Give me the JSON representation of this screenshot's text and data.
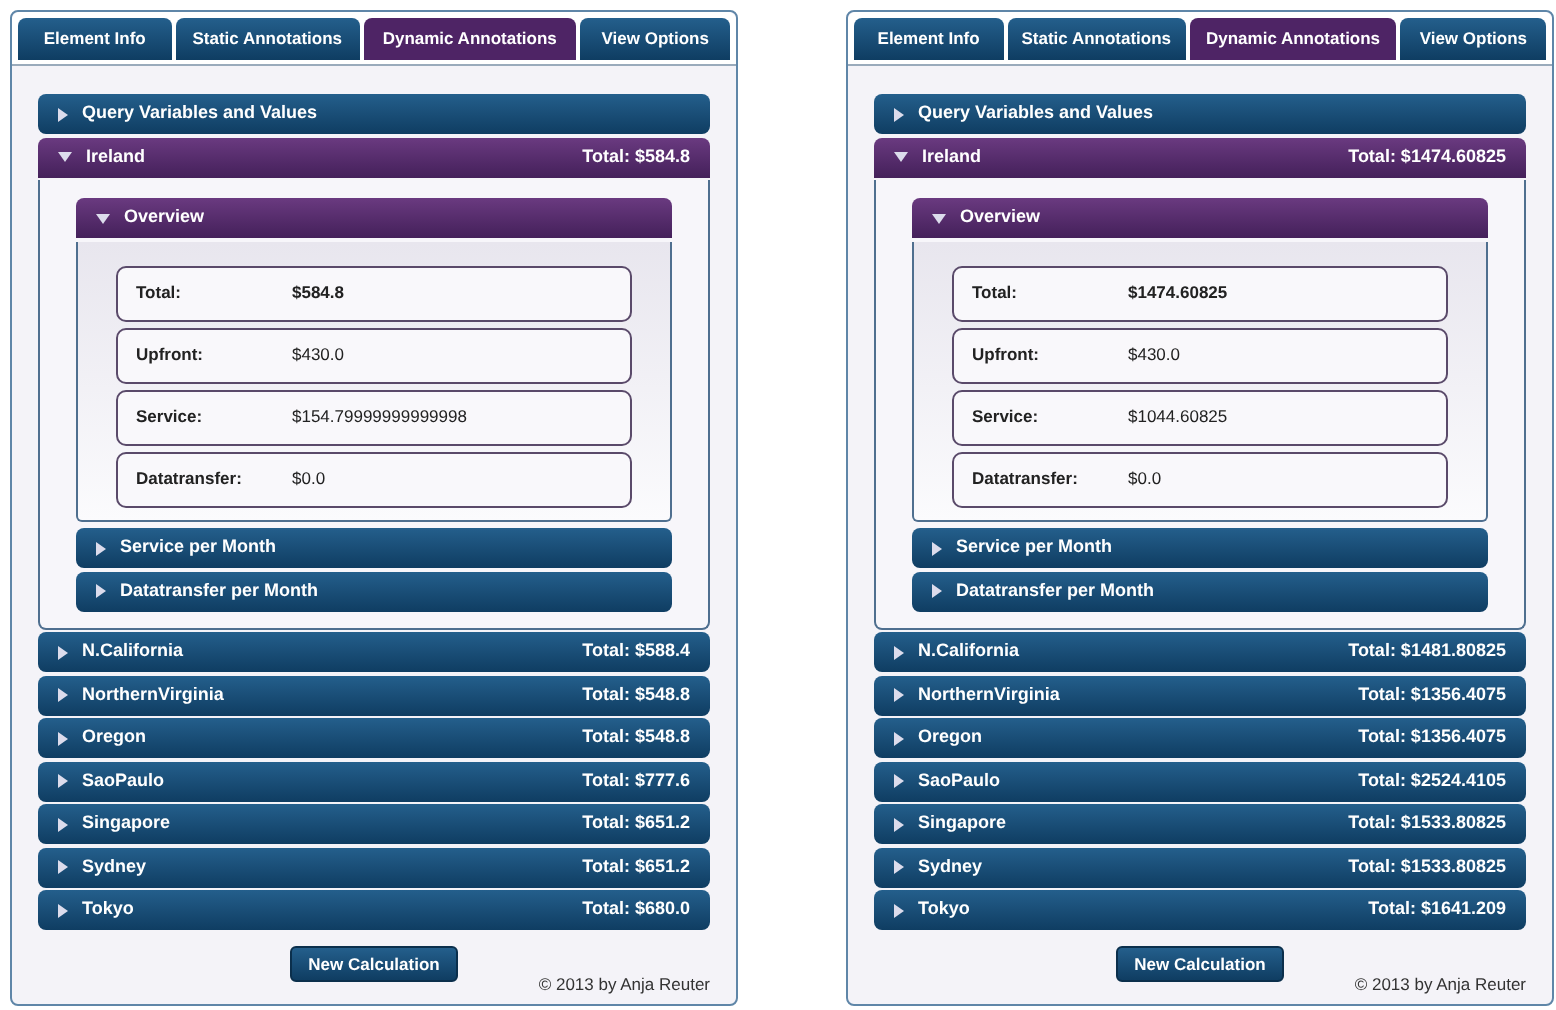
{
  "panels": [
    {
      "tabs": [
        {
          "label": "Element Info",
          "selected": false
        },
        {
          "label": "Static Annotations",
          "selected": false
        },
        {
          "label": "Dynamic Annotations",
          "selected": true
        },
        {
          "label": "View Options",
          "selected": false
        }
      ],
      "sections": [
        {
          "title": "Query Variables and Values",
          "expanded": false
        },
        {
          "title": "Ireland",
          "total": "Total: $584.8",
          "expanded": true,
          "subsections": [
            {
              "title": "Overview",
              "expanded": true,
              "rows": [
                {
                  "label": "Total:",
                  "value": "$584.8"
                },
                {
                  "label": "Upfront:",
                  "value": "$430.0"
                },
                {
                  "label": "Service:",
                  "value": "$154.79999999999998"
                },
                {
                  "label": "Datatransfer:",
                  "value": "$0.0"
                }
              ]
            },
            {
              "title": "Service per Month",
              "expanded": false
            },
            {
              "title": "Datatransfer per Month",
              "expanded": false
            }
          ]
        },
        {
          "title": "N.California",
          "total": "Total: $588.4",
          "expanded": false
        },
        {
          "title": "NorthernVirginia",
          "total": "Total: $548.8",
          "expanded": false
        },
        {
          "title": "Oregon",
          "total": "Total: $548.8",
          "expanded": false
        },
        {
          "title": "SaoPaulo",
          "total": "Total: $777.6",
          "expanded": false
        },
        {
          "title": "Singapore",
          "total": "Total: $651.2",
          "expanded": false
        },
        {
          "title": "Sydney",
          "total": "Total: $651.2",
          "expanded": false
        },
        {
          "title": "Tokyo",
          "total": "Total: $680.0",
          "expanded": false
        }
      ],
      "button": "New Calculation",
      "footer": "© 2013 by Anja Reuter"
    },
    {
      "tabs": [
        {
          "label": "Element Info",
          "selected": false
        },
        {
          "label": "Static Annotations",
          "selected": false
        },
        {
          "label": "Dynamic Annotations",
          "selected": true
        },
        {
          "label": "View Options",
          "selected": false
        }
      ],
      "sections": [
        {
          "title": "Query Variables and Values",
          "expanded": false
        },
        {
          "title": "Ireland",
          "total": "Total: $1474.60825",
          "expanded": true,
          "subsections": [
            {
              "title": "Overview",
              "expanded": true,
              "rows": [
                {
                  "label": "Total:",
                  "value": "$1474.60825"
                },
                {
                  "label": "Upfront:",
                  "value": "$430.0"
                },
                {
                  "label": "Service:",
                  "value": "$1044.60825"
                },
                {
                  "label": "Datatransfer:",
                  "value": "$0.0"
                }
              ]
            },
            {
              "title": "Service per Month",
              "expanded": false
            },
            {
              "title": "Datatransfer per Month",
              "expanded": false
            }
          ]
        },
        {
          "title": "N.California",
          "total": "Total: $1481.80825",
          "expanded": false
        },
        {
          "title": "NorthernVirginia",
          "total": "Total: $1356.4075",
          "expanded": false
        },
        {
          "title": "Oregon",
          "total": "Total: $1356.4075",
          "expanded": false
        },
        {
          "title": "SaoPaulo",
          "total": "Total: $2524.4105",
          "expanded": false
        },
        {
          "title": "Singapore",
          "total": "Total: $1533.80825",
          "expanded": false
        },
        {
          "title": "Sydney",
          "total": "Total: $1533.80825",
          "expanded": false
        },
        {
          "title": "Tokyo",
          "total": "Total: $1641.209",
          "expanded": false
        }
      ],
      "button": "New Calculation",
      "footer": "© 2013 by Anja Reuter"
    }
  ]
}
